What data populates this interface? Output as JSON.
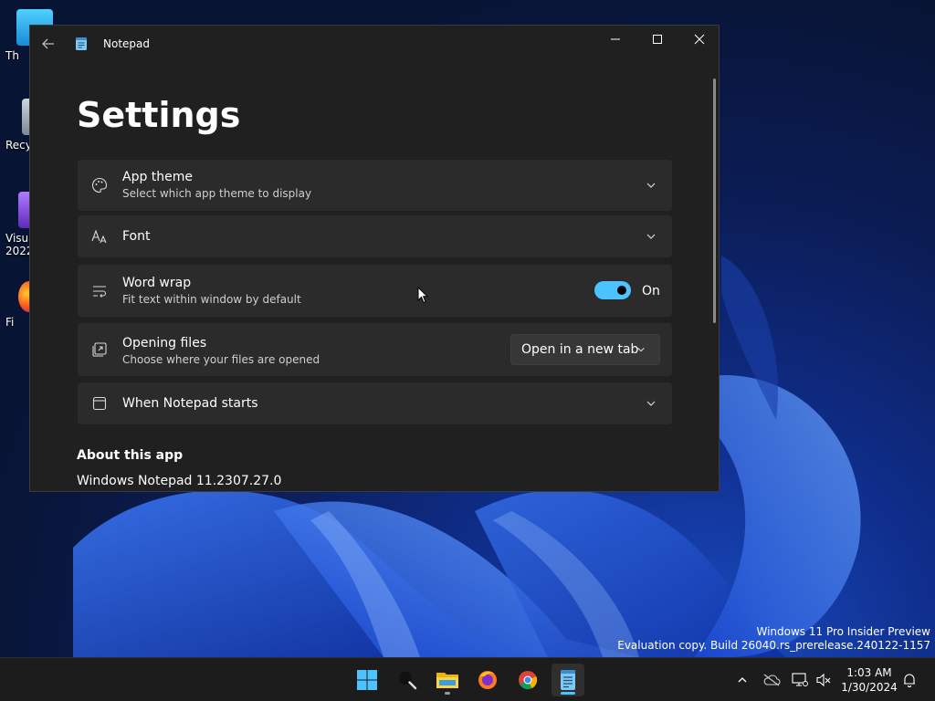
{
  "desktop": {
    "icons": [
      {
        "label": "Th"
      },
      {
        "label": "Recy"
      },
      {
        "label": "Visua"
      },
      {
        "label": "2022"
      },
      {
        "label": "Fi"
      }
    ],
    "watermark_line1": "Windows 11 Pro Insider Preview",
    "watermark_line2": "Evaluation copy. Build 26040.rs_prerelease.240122-1157"
  },
  "window": {
    "app_title": "Notepad",
    "page_title": "Settings",
    "settings": {
      "app_theme": {
        "title": "App theme",
        "subtitle": "Select which app theme to display"
      },
      "font": {
        "title": "Font"
      },
      "word_wrap": {
        "title": "Word wrap",
        "subtitle": "Fit text within window by default",
        "toggle_label": "On",
        "enabled": true
      },
      "opening_files": {
        "title": "Opening files",
        "subtitle": "Choose where your files are opened",
        "selected": "Open in a new tab"
      },
      "when_starts": {
        "title": "When Notepad starts"
      }
    },
    "about": {
      "title": "About this app",
      "version": "Windows Notepad 11.2307.27.0"
    }
  },
  "taskbar": {
    "apps": [
      "start-icon",
      "search-icon",
      "file-explorer-icon",
      "firefox-icon",
      "chrome-icon",
      "notepad-icon"
    ],
    "clock": {
      "time": "1:03 AM",
      "date": "1/30/2024"
    }
  },
  "colors": {
    "accent": "#4cc2ff",
    "card": "#2b2b2b",
    "window": "#202020",
    "taskbar": "#1c1c1c"
  }
}
